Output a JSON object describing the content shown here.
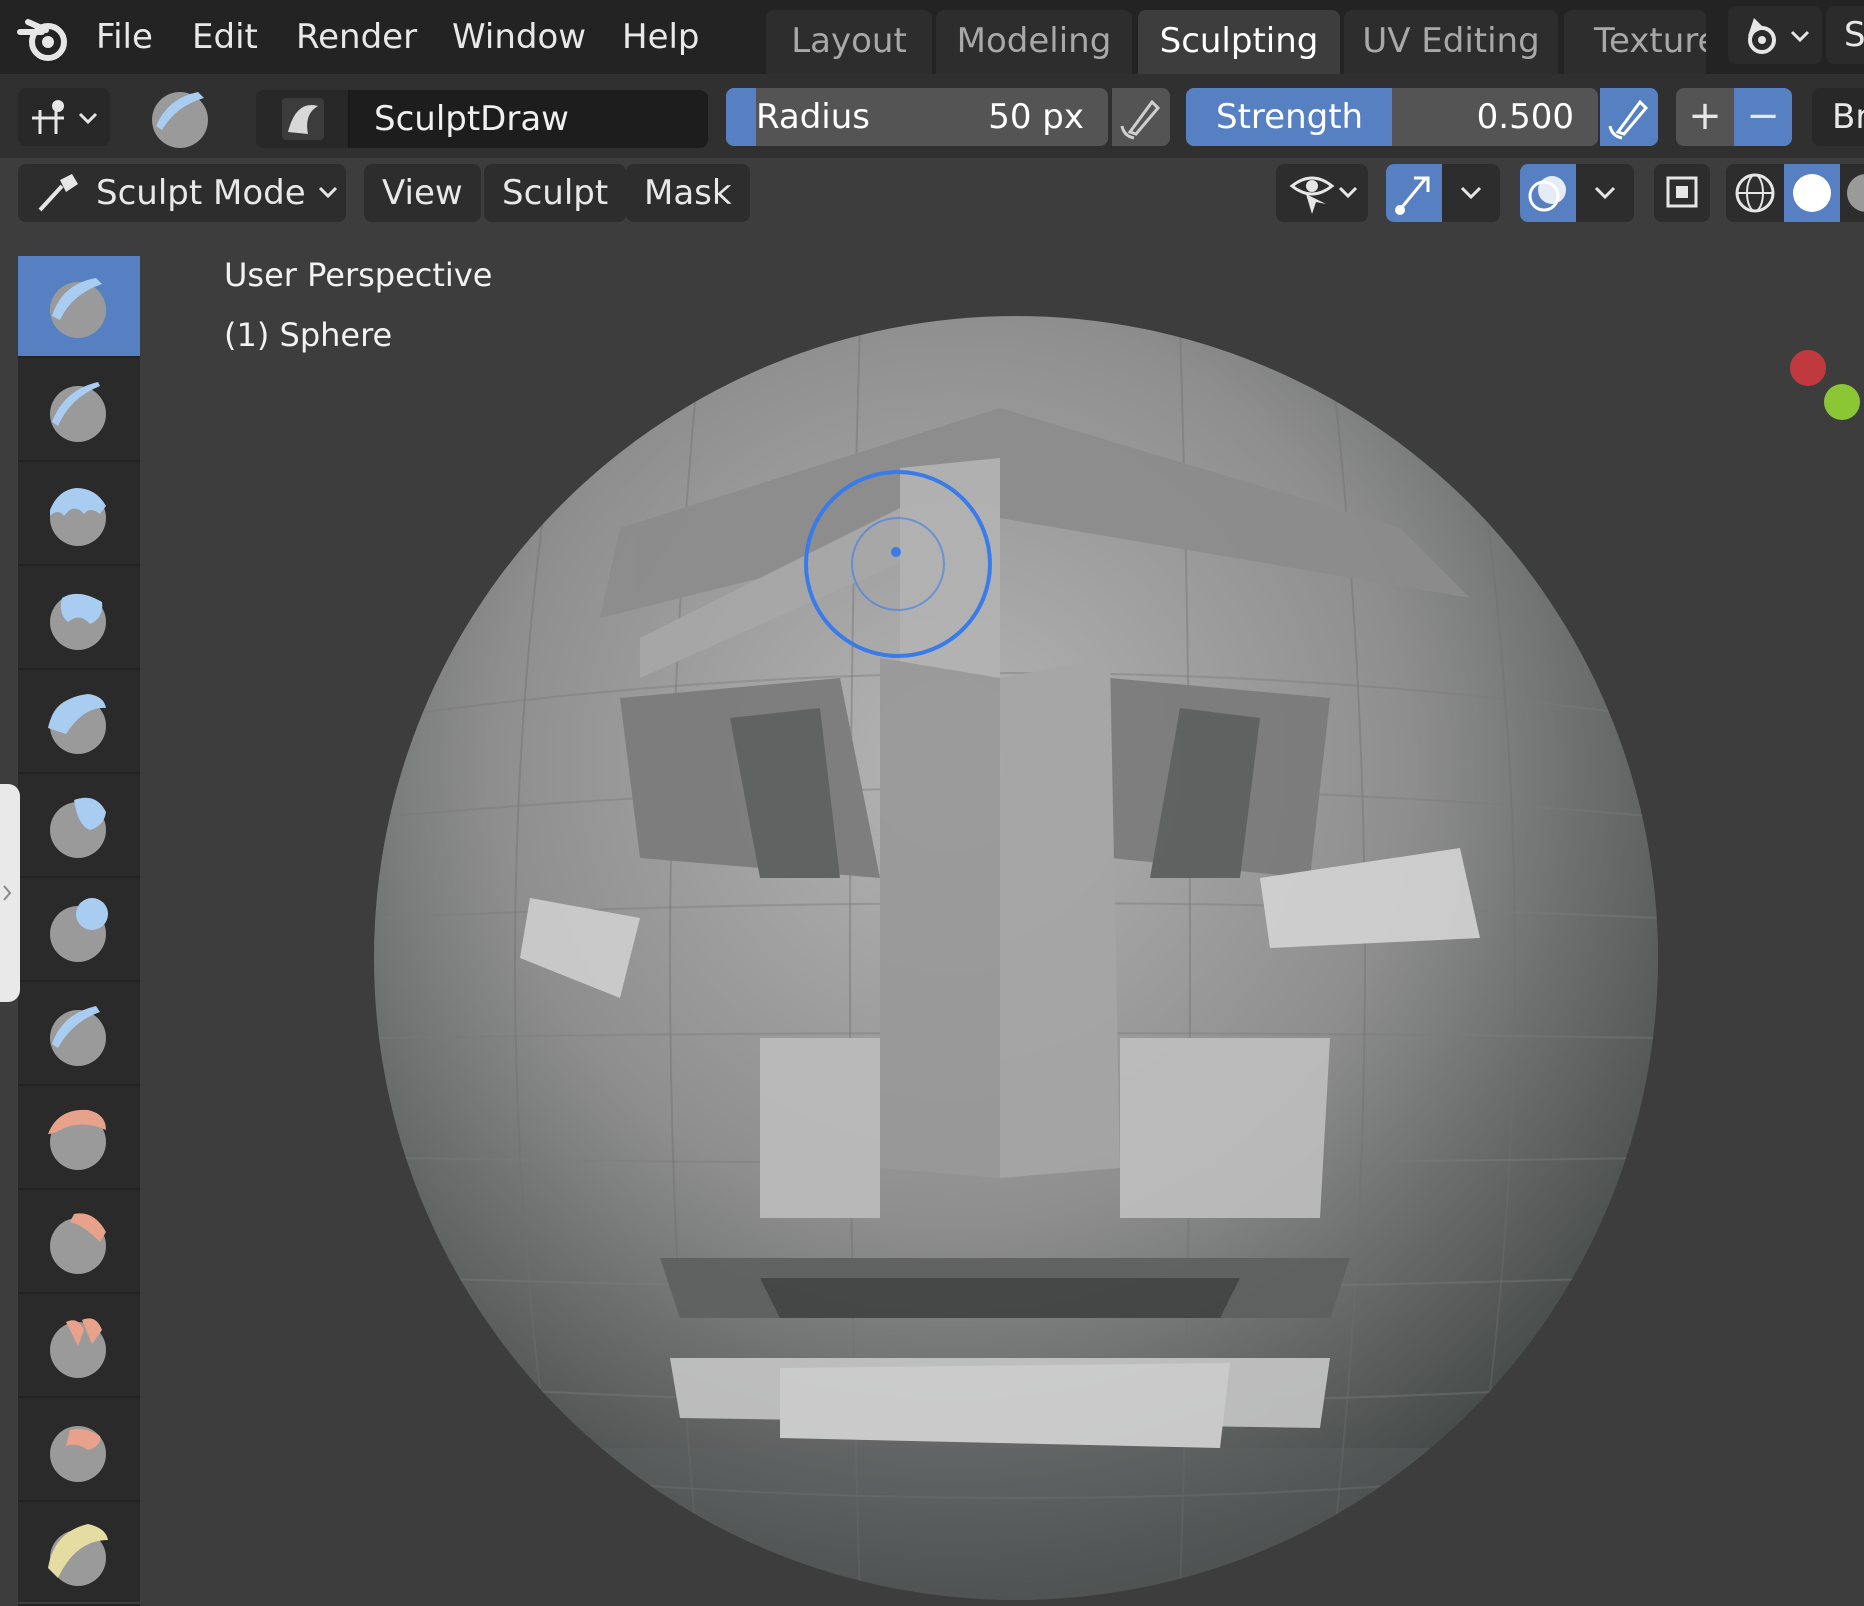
{
  "menu": {
    "items": [
      "File",
      "Edit",
      "Render",
      "Window",
      "Help"
    ]
  },
  "workspaces": {
    "tabs": [
      "Layout",
      "Modeling",
      "Sculpting",
      "UV Editing",
      "Texture"
    ],
    "active": "Sculpting"
  },
  "scene_label": "S",
  "tool_header": {
    "brush_name": "SculptDraw",
    "radius_label": "Radius",
    "radius_value": "50 px",
    "strength_label": "Strength",
    "strength_value": "0.500",
    "strength_fraction": 0.5,
    "plus_label": "+",
    "minus_label": "−",
    "brush_menu_label": "Br"
  },
  "viewport_header": {
    "mode_label": "Sculpt Mode",
    "menus": [
      "View",
      "Sculpt",
      "Mask"
    ]
  },
  "viewport": {
    "perspective": "User Perspective",
    "object": "(1) Sphere"
  },
  "tools": [
    {
      "name": "draw",
      "accent": "#a9cdf0",
      "active": true
    },
    {
      "name": "draw-sharp",
      "accent": "#a9cdf0"
    },
    {
      "name": "clay",
      "accent": "#a9cdf0"
    },
    {
      "name": "clay-strips",
      "accent": "#a9cdf0"
    },
    {
      "name": "layer",
      "accent": "#a9cdf0"
    },
    {
      "name": "inflate",
      "accent": "#a9cdf0"
    },
    {
      "name": "blob",
      "accent": "#a9cdf0"
    },
    {
      "name": "crease",
      "accent": "#a9cdf0"
    },
    {
      "name": "smooth",
      "accent": "#e8a18a"
    },
    {
      "name": "flatten",
      "accent": "#e8a18a"
    },
    {
      "name": "fill",
      "accent": "#e8a18a"
    },
    {
      "name": "scrape",
      "accent": "#e8a18a"
    },
    {
      "name": "multiplane-scrape",
      "accent": "#e5dca1"
    }
  ],
  "colors": {
    "accent_blue": "#5680c2",
    "brush_cursor": "#3a7bea",
    "gizmo_x": "#c0393f",
    "gizmo_y": "#8bc735"
  }
}
